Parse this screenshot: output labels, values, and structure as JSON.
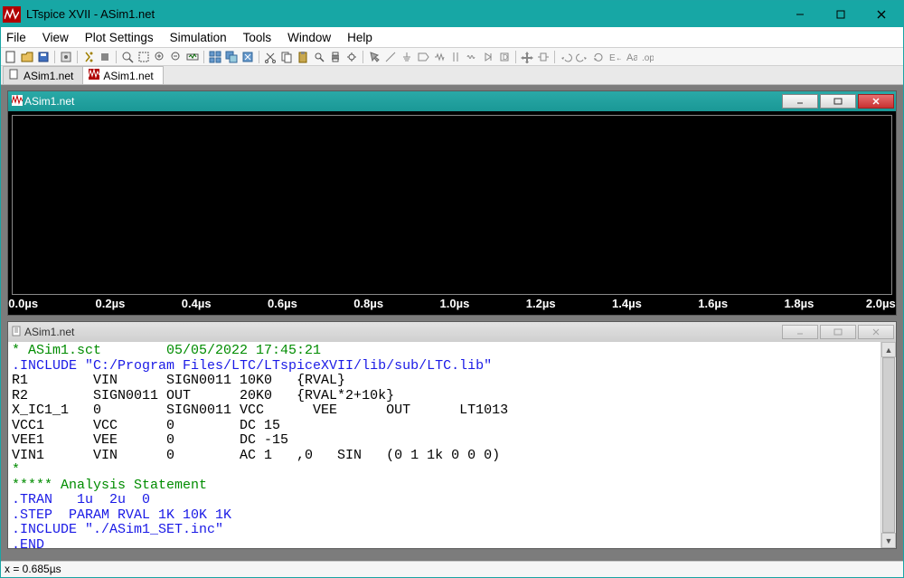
{
  "window": {
    "title": "LTspice XVII - ASim1.net"
  },
  "menu": {
    "file": "File",
    "view": "View",
    "plot": "Plot Settings",
    "sim": "Simulation",
    "tools": "Tools",
    "window": "Window",
    "help": "Help"
  },
  "tabs": {
    "t1": "ASim1.net",
    "t2": "ASim1.net"
  },
  "mdi_plot": {
    "title": "ASim1.net"
  },
  "mdi_net": {
    "title": "ASim1.net"
  },
  "xaxis": {
    "t0": "0.0µs",
    "t1": "0.2µs",
    "t2": "0.4µs",
    "t3": "0.6µs",
    "t4": "0.8µs",
    "t5": "1.0µs",
    "t6": "1.2µs",
    "t7": "1.4µs",
    "t8": "1.6µs",
    "t9": "1.8µs",
    "t10": "2.0µs"
  },
  "netlist": {
    "l1": "* ASim1.sct        05/05/2022 17:45:21",
    "l2": ".INCLUDE \"C:/Program Files/LTC/LTspiceXVII/lib/sub/LTC.lib\"",
    "l3": "R1        VIN      SIGN0011 10K0   {RVAL}",
    "l4": "R2        SIGN0011 OUT      20K0   {RVAL*2+10k}",
    "l5": "X_IC1_1   0        SIGN0011 VCC      VEE      OUT      LT1013",
    "l6": "VCC1      VCC      0        DC 15",
    "l7": "VEE1      VEE      0        DC -15",
    "l8": "VIN1      VIN      0        AC 1   ,0   SIN   (0 1 1k 0 0 0)",
    "l9": "*",
    "l10": "***** Analysis Statement",
    "l11": ".TRAN   1u  2u  0",
    "l12": ".STEP  PARAM RVAL 1K 10K 1K",
    "l13": ".INCLUDE \"./ASim1_SET.inc\"",
    "l14": ".END"
  },
  "status": {
    "text": "x = 0.685µs"
  }
}
